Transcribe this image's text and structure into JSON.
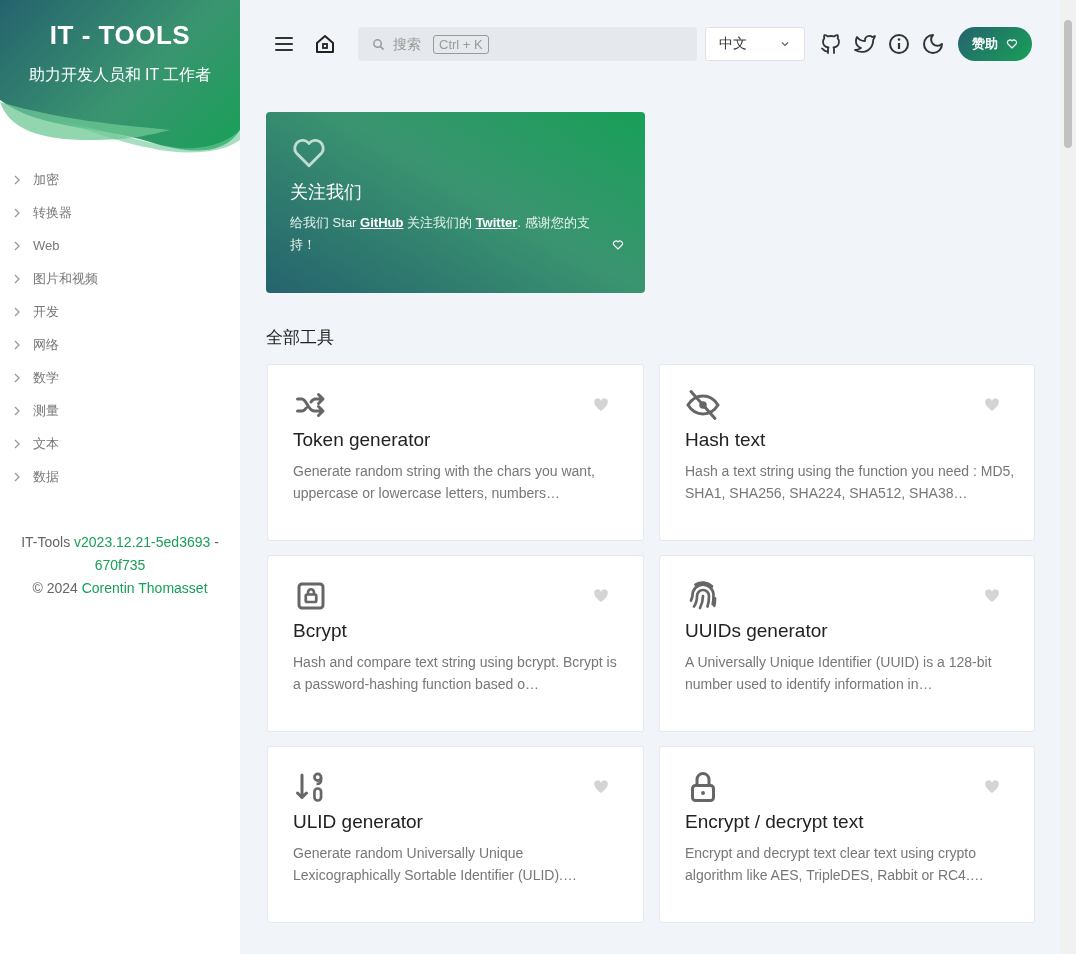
{
  "sidebar": {
    "title": "IT - TOOLS",
    "subtitle": "助力开发人员和 IT 工作者",
    "items": [
      {
        "label": "加密",
        "expanded": false
      },
      {
        "label": "转换器",
        "expanded": false
      },
      {
        "label": "Web",
        "expanded": false
      },
      {
        "label": "图片和视频",
        "expanded": false
      },
      {
        "label": "开发",
        "expanded": false
      },
      {
        "label": "网络",
        "expanded": false
      },
      {
        "label": "数学",
        "expanded": false
      },
      {
        "label": "测量",
        "expanded": false
      },
      {
        "label": "文本",
        "expanded": false
      },
      {
        "label": "数据",
        "expanded": false
      }
    ],
    "footer": [
      [
        {
          "kind": "text",
          "text": "IT-Tools "
        },
        {
          "kind": "link",
          "text": "v2023.12.21-5ed3693"
        },
        {
          "kind": "text",
          "text": " - "
        },
        {
          "kind": "link",
          "text": "670f735"
        }
      ],
      [
        {
          "kind": "text",
          "text": "© 2024 "
        },
        {
          "kind": "link",
          "text": "Corentin Thomasset"
        }
      ]
    ]
  },
  "topbar": {
    "search": {
      "placeholder": "搜索",
      "shortcut": "Ctrl + K"
    },
    "language": "中文",
    "sponsor": "赞助"
  },
  "follow_card": {
    "title": "关注我们",
    "parts": [
      {
        "kind": "text",
        "text": "给我们 Star "
      },
      {
        "kind": "link",
        "text": "GitHub"
      },
      {
        "kind": "text",
        "text": " 关注我们的 "
      },
      {
        "kind": "link",
        "text": "Twitter"
      },
      {
        "kind": "text",
        "text": ". 感谢您的支持！"
      }
    ]
  },
  "section_title": "全部工具",
  "tools": [
    {
      "kind": "shuffle",
      "title": "Token generator",
      "description": "Generate random string with the chars you want, uppercase or lowercase letters, numbers…",
      "favorite": false
    },
    {
      "kind": "eye-off",
      "title": "Hash text",
      "description": "Hash a text string using the function you need : MD5, SHA1, SHA256, SHA224, SHA512, SHA38…",
      "favorite": false
    },
    {
      "kind": "lock-box",
      "title": "Bcrypt",
      "description": "Hash and compare text string using bcrypt. Bcrypt is a password-hashing function based o…",
      "favorite": false
    },
    {
      "kind": "fingerprint",
      "title": "UUIDs generator",
      "description": "A Universally Unique Identifier (UUID) is a 128-bit number used to identify information in…",
      "favorite": false
    },
    {
      "kind": "sort-numeric",
      "title": "ULID generator",
      "description": "Generate random Universally Unique Lexicographically Sortable Identifier (ULID).…",
      "favorite": false
    },
    {
      "kind": "lock",
      "title": "Encrypt / decrypt text",
      "description": "Encrypt and decrypt text clear text using crypto algorithm like AES, TripleDES, Rabbit or RC4.…",
      "favorite": false
    }
  ]
}
